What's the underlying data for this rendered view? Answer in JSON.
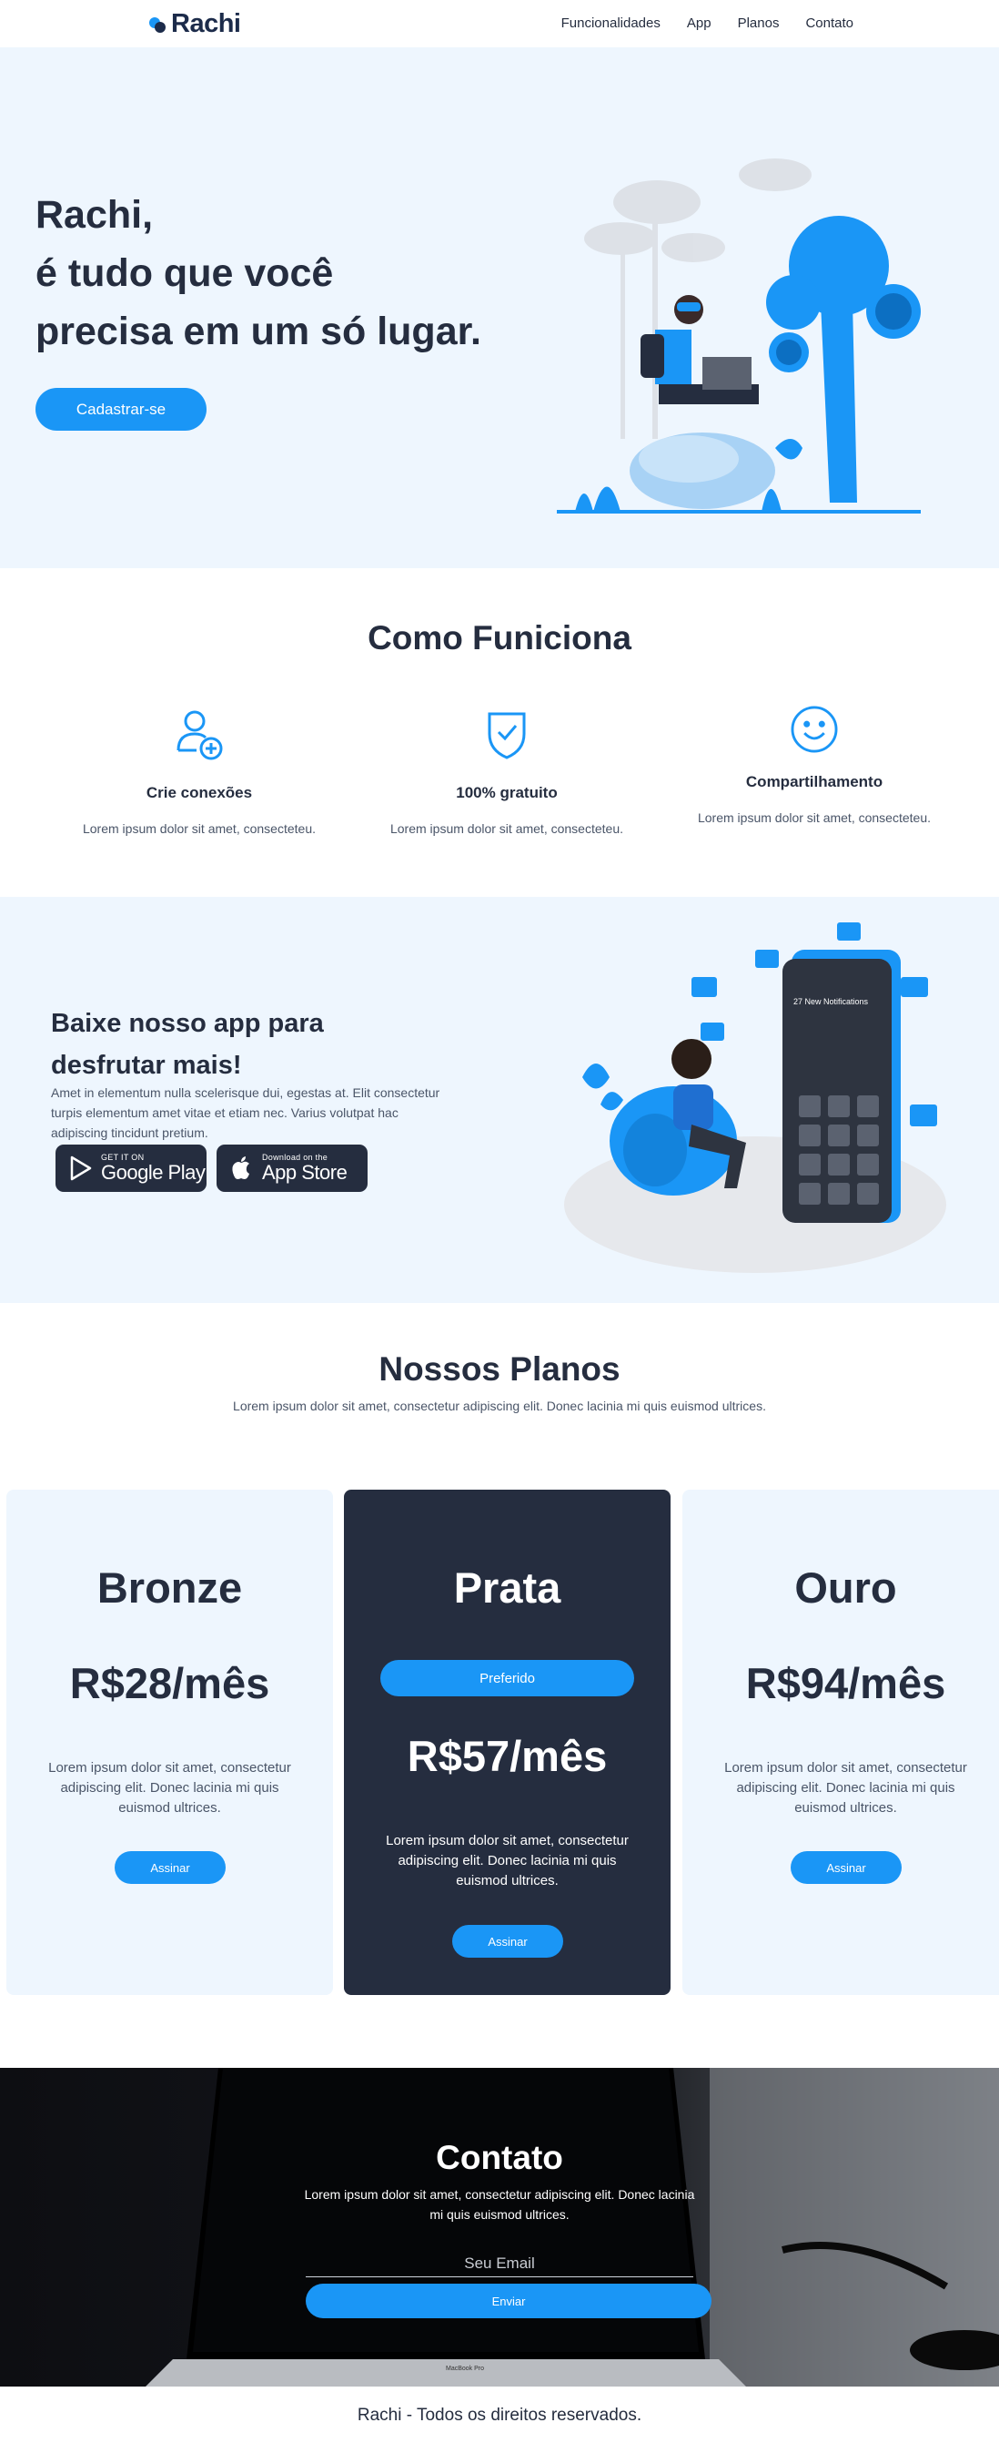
{
  "nav": {
    "brand": "Rachi",
    "links": [
      "Funcionalidades",
      "App",
      "Planos",
      "Contato"
    ]
  },
  "hero": {
    "title_lines": [
      "Rachi,",
      "é tudo que você",
      "precisa em um só lugar."
    ],
    "cta": "Cadastrar-se"
  },
  "how": {
    "title": "Como Funiciona",
    "features": [
      {
        "icon": "user-plus-icon",
        "title": "Crie conexões",
        "text": "Lorem ipsum dolor sit amet, consecteteu."
      },
      {
        "icon": "shield-check-icon",
        "title": "100% gratuito",
        "text": "Lorem ipsum dolor sit amet, consecteteu."
      },
      {
        "icon": "smile-icon",
        "title": "Compartilhamento",
        "text": "Lorem ipsum dolor sit amet, consecteteu."
      }
    ]
  },
  "app": {
    "title_lines": [
      "Baixe nosso app para",
      "desfrutar mais!"
    ],
    "text": "Amet in elementum nulla scelerisque dui, egestas at. Elit consectetur turpis elementum amet vitae et etiam nec. Varius volutpat hac adipiscing tincidunt pretium.",
    "google_play": {
      "small": "GET IT ON",
      "big": "Google Play"
    },
    "app_store": {
      "small": "Download on the",
      "big": "App Store"
    },
    "phone_header": "27 New Notifications"
  },
  "plans": {
    "title": "Nossos Planos",
    "subtitle": "Lorem ipsum dolor sit amet, consectetur adipiscing elit. Donec lacinia mi quis euismod ultrices.",
    "items": [
      {
        "name": "Bronze",
        "price": "R$28/mês",
        "text": "Lorem ipsum dolor sit amet, consectetur adipiscing elit. Donec lacinia mi quis euismod ultrices.",
        "button": "Assinar"
      },
      {
        "name": "Prata",
        "badge": "Preferido",
        "price": "R$57/mês",
        "text": "Lorem ipsum dolor sit amet, consectetur adipiscing elit. Donec lacinia mi quis euismod ultrices.",
        "button": "Assinar"
      },
      {
        "name": "Ouro",
        "price": "R$94/mês",
        "text": "Lorem ipsum dolor sit amet, consectetur adipiscing elit. Donec lacinia mi quis euismod ultrices.",
        "button": "Assinar"
      }
    ]
  },
  "contact": {
    "title": "Contato",
    "text": "Lorem ipsum dolor sit amet, consectetur adipiscing elit. Donec lacinia mi quis euismod ultrices.",
    "email_placeholder": "Seu Email",
    "button": "Enviar",
    "laptop_label": "MacBook Pro"
  },
  "footer": {
    "text": "Rachi - Todos os direitos reservados."
  },
  "colors": {
    "accent": "#1a96f6",
    "dark": "#252d3f",
    "light_bg": "#eef6fe"
  }
}
